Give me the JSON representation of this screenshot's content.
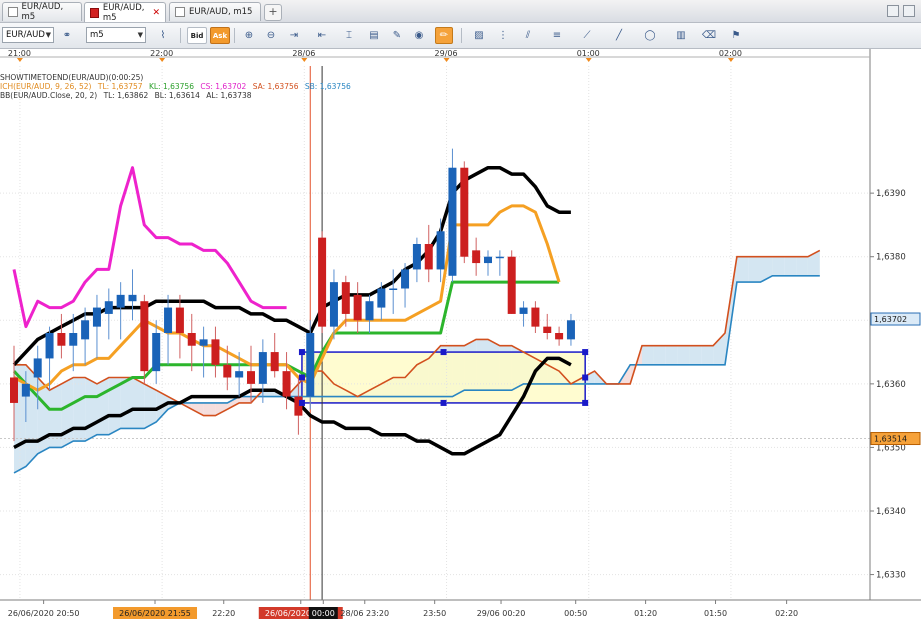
{
  "tabs": [
    {
      "label": "EUR/AUD, m5",
      "active": false,
      "icon": "chart-tab-icon"
    },
    {
      "label": "EUR/AUD, m5",
      "active": true,
      "icon": "chart-tab-icon-red"
    },
    {
      "label": "EUR/AUD, m15",
      "active": false,
      "icon": "chart-tab-icon"
    }
  ],
  "toolbar": {
    "symbol": "EUR/AUD",
    "timeframe": "m5",
    "bid_label": "Bid",
    "ask_label": "Ask"
  },
  "legend": {
    "line1": "SHOWTIMETOEND(EUR/AUD)(0:00:25)",
    "ichimoku": {
      "name": "ICH(EUR/AUD, 9, 26, 52)",
      "tl": "TL: 1,63757",
      "kl": "KL: 1,63756",
      "cs": "CS: 1,63702",
      "sa": "SA: 1,63756",
      "sb": "SB: 1,63756"
    },
    "bb": {
      "name": "BB(EUR/AUD.Close, 20, 2)",
      "tl": "TL: 1,63862",
      "bl": "BL: 1,63614",
      "al": "AL: 1,63738"
    }
  },
  "colors": {
    "bull": "#1a63b8",
    "bear": "#cc1f1f",
    "tenkan": "#f5a023",
    "kijun": "#2cb52c",
    "chikou": "#ee22cc",
    "senkou_a": "#d2501e",
    "senkou_b": "#2a86c2",
    "bollinger": "#000000",
    "rect_fill": "#fffbc8",
    "rect_border": "#1a1ac8"
  },
  "chart_data": {
    "type": "candlestick",
    "symbol": "EUR/AUD",
    "timeframe": "m5",
    "ylim": [
      1.6326,
      1.641
    ],
    "yticks": [
      1.633,
      1.634,
      1.635,
      1.636,
      1.637,
      1.638,
      1.639
    ],
    "ytick_labels": [
      "1,6330",
      "1,6340",
      "1,6350",
      "1,6360",
      "1,6370",
      "1,6380",
      "1,6390"
    ],
    "price_markers": [
      {
        "label": "1,63702",
        "value": 1.63702,
        "color": "#2a6fb5",
        "fill": "#dbeaf7"
      },
      {
        "label": "1,63514",
        "value": 1.63514,
        "color": "#b85f00",
        "fill": "#f6a23a"
      }
    ],
    "top_time_labels": [
      {
        "label": "21:00",
        "slot": 0.5
      },
      {
        "label": "22:00",
        "slot": 12.5
      },
      {
        "label": "28/06",
        "slot": 24.5
      },
      {
        "label": "29/06",
        "slot": 36.5
      },
      {
        "label": "01:00",
        "slot": 48.5
      },
      {
        "label": "02:00",
        "slot": 60.5
      }
    ],
    "bottom_time_labels": [
      {
        "label": "26/06/2020 20:50",
        "slot": 2.5,
        "style": "plain"
      },
      {
        "label": "26/06/2020 21:55",
        "slot": 11.9,
        "style": "orange"
      },
      {
        "label": "22:20",
        "slot": 17.7,
        "style": "plain"
      },
      {
        "label": "26/06/2020 22:55",
        "slot": 24.2,
        "style": "red"
      },
      {
        "label": "00:00",
        "slot": 26.1,
        "style": "black"
      },
      {
        "label": "28/06 23:20",
        "slot": 29.6,
        "style": "plain"
      },
      {
        "label": "23:50",
        "slot": 35.5,
        "style": "plain"
      },
      {
        "label": "29/06 00:20",
        "slot": 41.1,
        "style": "plain"
      },
      {
        "label": "00:50",
        "slot": 47.4,
        "style": "plain"
      },
      {
        "label": "01:20",
        "slot": 53.3,
        "style": "plain"
      },
      {
        "label": "01:50",
        "slot": 59.2,
        "style": "plain"
      },
      {
        "label": "02:20",
        "slot": 65.2,
        "style": "plain"
      }
    ],
    "candles": [
      [
        1.6361,
        1.6366,
        1.6351,
        1.6357
      ],
      [
        1.6358,
        1.6362,
        1.6354,
        1.636
      ],
      [
        1.6361,
        1.6366,
        1.6356,
        1.6364
      ],
      [
        1.6364,
        1.6369,
        1.6359,
        1.6368
      ],
      [
        1.6368,
        1.6371,
        1.6364,
        1.6366
      ],
      [
        1.6366,
        1.6371,
        1.6362,
        1.6368
      ],
      [
        1.6367,
        1.6372,
        1.6363,
        1.637
      ],
      [
        1.6369,
        1.6374,
        1.6364,
        1.6372
      ],
      [
        1.6371,
        1.6375,
        1.6367,
        1.6373
      ],
      [
        1.6372,
        1.6376,
        1.6367,
        1.6374
      ],
      [
        1.6373,
        1.6378,
        1.637,
        1.6374
      ],
      [
        1.6373,
        1.6374,
        1.636,
        1.6362
      ],
      [
        1.6362,
        1.637,
        1.636,
        1.6368
      ],
      [
        1.6368,
        1.6374,
        1.6363,
        1.6372
      ],
      [
        1.6372,
        1.6374,
        1.6364,
        1.6368
      ],
      [
        1.6368,
        1.6371,
        1.6362,
        1.6366
      ],
      [
        1.6366,
        1.6369,
        1.6361,
        1.6367
      ],
      [
        1.6367,
        1.6369,
        1.6361,
        1.6363
      ],
      [
        1.6363,
        1.6366,
        1.6359,
        1.6361
      ],
      [
        1.6361,
        1.6365,
        1.6358,
        1.6362
      ],
      [
        1.6362,
        1.6366,
        1.6357,
        1.636
      ],
      [
        1.636,
        1.6367,
        1.6357,
        1.6365
      ],
      [
        1.6365,
        1.6368,
        1.6361,
        1.6362
      ],
      [
        1.6362,
        1.6365,
        1.6356,
        1.6358
      ],
      [
        1.6358,
        1.6361,
        1.6352,
        1.6355
      ],
      [
        1.6358,
        1.637,
        1.6356,
        1.6368
      ],
      [
        1.6383,
        1.6384,
        1.6368,
        1.6369
      ],
      [
        1.6369,
        1.6378,
        1.6367,
        1.6376
      ],
      [
        1.6376,
        1.6377,
        1.6369,
        1.6371
      ],
      [
        1.6374,
        1.6376,
        1.6368,
        1.637
      ],
      [
        1.637,
        1.6374,
        1.6368,
        1.6373
      ],
      [
        1.6372,
        1.6376,
        1.637,
        1.6375
      ],
      [
        1.6375,
        1.6378,
        1.6371,
        1.6375
      ],
      [
        1.6375,
        1.6379,
        1.6372,
        1.6378
      ],
      [
        1.6378,
        1.6383,
        1.6376,
        1.6382
      ],
      [
        1.6382,
        1.6385,
        1.6376,
        1.6378
      ],
      [
        1.6378,
        1.6386,
        1.6376,
        1.6384
      ],
      [
        1.6377,
        1.6397,
        1.6376,
        1.6394
      ],
      [
        1.6394,
        1.6395,
        1.6379,
        1.638
      ],
      [
        1.6381,
        1.6383,
        1.6377,
        1.6379
      ],
      [
        1.6379,
        1.6381,
        1.6377,
        1.638
      ],
      [
        1.638,
        1.6381,
        1.6377,
        1.638
      ],
      [
        1.638,
        1.6381,
        1.6371,
        1.6371
      ],
      [
        1.6371,
        1.6373,
        1.6369,
        1.6372
      ],
      [
        1.6372,
        1.6373,
        1.6368,
        1.6369
      ],
      [
        1.6369,
        1.6371,
        1.6367,
        1.6368
      ],
      [
        1.6368,
        1.6369,
        1.6366,
        1.6367
      ],
      [
        1.6367,
        1.6371,
        1.6366,
        1.637
      ]
    ],
    "tenkan": [
      1.6361,
      1.636,
      1.6359,
      1.636,
      1.6362,
      1.6363,
      1.6363,
      1.6364,
      1.6364,
      1.6366,
      1.6368,
      1.637,
      1.6369,
      1.6368,
      1.6368,
      1.6367,
      1.6366,
      1.6366,
      1.6365,
      1.6364,
      1.6363,
      1.6363,
      1.6363,
      1.6363,
      1.6361,
      1.636,
      1.6364,
      1.6368,
      1.637,
      1.637,
      1.637,
      1.637,
      1.637,
      1.637,
      1.6371,
      1.6372,
      1.6373,
      1.6385,
      1.6385,
      1.6385,
      1.6385,
      1.6387,
      1.6388,
      1.6388,
      1.6387,
      1.6382,
      1.6376
    ],
    "kijun": [
      1.6362,
      1.636,
      1.6358,
      1.6356,
      1.6356,
      1.6357,
      1.6358,
      1.6358,
      1.6359,
      1.636,
      1.6361,
      1.6361,
      1.6363,
      1.6363,
      1.6363,
      1.6363,
      1.6363,
      1.6363,
      1.6363,
      1.6363,
      1.6363,
      1.6363,
      1.6363,
      1.6363,
      1.6362,
      1.6361,
      1.6365,
      1.6368,
      1.6368,
      1.6368,
      1.6368,
      1.6368,
      1.6368,
      1.6368,
      1.6368,
      1.6368,
      1.6368,
      1.6376,
      1.6376,
      1.6376,
      1.6376,
      1.6376,
      1.6376,
      1.6376,
      1.6376,
      1.6376,
      1.6376
    ],
    "chikou": [
      1.6378,
      1.6369,
      1.6373,
      1.6372,
      1.6372,
      1.6373,
      1.6376,
      1.6378,
      1.6378,
      1.6388,
      1.6394,
      1.6385,
      1.6383,
      1.6383,
      1.6382,
      1.6382,
      1.6381,
      1.6381,
      1.6379,
      1.6376,
      1.6373,
      1.6372,
      1.6372,
      1.6372
    ],
    "senkou_a": [
      1.6363,
      1.6363,
      1.6361,
      1.6359,
      1.636,
      1.6361,
      1.6361,
      1.636,
      1.6361,
      1.6361,
      1.6361,
      1.636,
      1.6359,
      1.6358,
      1.6357,
      1.6356,
      1.6355,
      1.6355,
      1.6356,
      1.6357,
      1.6357,
      1.6359,
      1.6359,
      1.6358,
      1.636,
      1.6362,
      1.6362,
      1.636,
      1.6359,
      1.6358,
      1.6359,
      1.636,
      1.6361,
      1.6361,
      1.6363,
      1.6364,
      1.6366,
      1.6366,
      1.6366,
      1.6367,
      1.6367,
      1.6366,
      1.6366,
      1.6365,
      1.6364,
      1.6363,
      1.6362,
      1.636,
      1.6361,
      1.6362,
      1.636,
      1.636,
      1.636,
      1.6366,
      1.6366,
      1.6366,
      1.6366,
      1.6366,
      1.6366,
      1.6366,
      1.6368,
      1.638,
      1.638,
      1.638,
      1.638,
      1.638,
      1.638,
      1.638,
      1.6381
    ],
    "senkou_b": [
      1.6346,
      1.6347,
      1.6349,
      1.635,
      1.635,
      1.6351,
      1.6351,
      1.6352,
      1.6352,
      1.6353,
      1.6353,
      1.6353,
      1.6354,
      1.6356,
      1.6357,
      1.6357,
      1.6357,
      1.6357,
      1.6357,
      1.6358,
      1.6358,
      1.6358,
      1.6358,
      1.6358,
      1.6358,
      1.6358,
      1.6358,
      1.6358,
      1.6358,
      1.6358,
      1.6358,
      1.6358,
      1.6358,
      1.6358,
      1.6358,
      1.6358,
      1.6358,
      1.6358,
      1.6359,
      1.6359,
      1.6359,
      1.6359,
      1.6359,
      1.636,
      1.636,
      1.636,
      1.636,
      1.636,
      1.636,
      1.636,
      1.636,
      1.636,
      1.6363,
      1.6363,
      1.6363,
      1.6363,
      1.6363,
      1.6363,
      1.6363,
      1.6363,
      1.6363,
      1.6376,
      1.6376,
      1.6376,
      1.6377,
      1.6377,
      1.6377,
      1.6377,
      1.6377
    ],
    "bb_upper": [
      1.6363,
      1.6365,
      1.6367,
      1.6368,
      1.6369,
      1.637,
      1.6371,
      1.6371,
      1.6372,
      1.6372,
      1.6372,
      1.6372,
      1.6373,
      1.6373,
      1.6373,
      1.6373,
      1.6373,
      1.6372,
      1.6372,
      1.6372,
      1.6371,
      1.6371,
      1.637,
      1.637,
      1.6369,
      1.6368,
      1.6372,
      1.6373,
      1.6374,
      1.6374,
      1.6374,
      1.6375,
      1.6376,
      1.6378,
      1.6379,
      1.6381,
      1.6384,
      1.639,
      1.6392,
      1.6393,
      1.6394,
      1.6394,
      1.6393,
      1.6393,
      1.6391,
      1.6388,
      1.6387,
      1.6387
    ],
    "bb_lower": [
      1.635,
      1.6351,
      1.6351,
      1.6352,
      1.6352,
      1.6353,
      1.6353,
      1.6354,
      1.6355,
      1.6355,
      1.6356,
      1.6356,
      1.6356,
      1.6357,
      1.6357,
      1.6358,
      1.6358,
      1.6358,
      1.6358,
      1.6358,
      1.6359,
      1.6359,
      1.6359,
      1.6358,
      1.6357,
      1.6355,
      1.6354,
      1.6354,
      1.6353,
      1.6353,
      1.6353,
      1.6352,
      1.6352,
      1.6352,
      1.6351,
      1.6351,
      1.635,
      1.6349,
      1.6349,
      1.635,
      1.6351,
      1.6352,
      1.6355,
      1.6358,
      1.6362,
      1.6364,
      1.6364,
      1.6363
    ],
    "rectangle": {
      "slot_start": 24.3,
      "slot_end": 48.2,
      "top": 1.6365,
      "bottom": 1.6357
    },
    "vertical_lines": [
      {
        "slot": 25,
        "color": "#e4512a"
      },
      {
        "slot": 26,
        "color": "#333333"
      }
    ]
  }
}
